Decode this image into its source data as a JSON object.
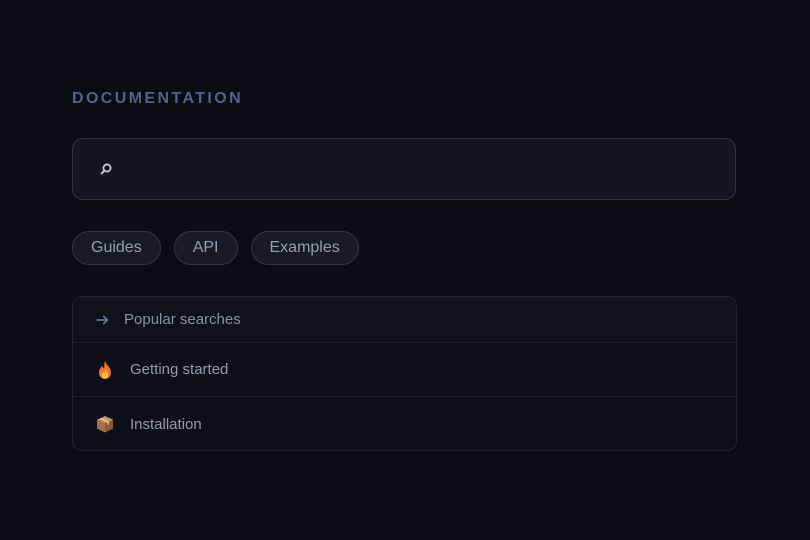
{
  "section": {
    "title": "DOCUMENTATION"
  },
  "search": {
    "icon": "search-icon",
    "value": "",
    "placeholder": ""
  },
  "chips": [
    {
      "label": "Guides"
    },
    {
      "label": "API"
    },
    {
      "label": "Examples"
    }
  ],
  "results": {
    "header": {
      "icon": "arrow-right-icon",
      "label": "Popular searches"
    },
    "items": [
      {
        "icon": "fire-icon",
        "label": "Getting started"
      },
      {
        "icon": "package-icon",
        "label": "Installation"
      }
    ]
  },
  "colors": {
    "background": "#0c0c17",
    "accent": "#5b5f86",
    "panel": "#151521",
    "text": "#9899ad"
  }
}
